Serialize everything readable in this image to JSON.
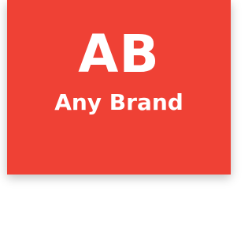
{
  "logo": {
    "monogram": "AB",
    "name": "Any Brand",
    "background_color": "#ef4135",
    "text_color": "#ffffff"
  }
}
